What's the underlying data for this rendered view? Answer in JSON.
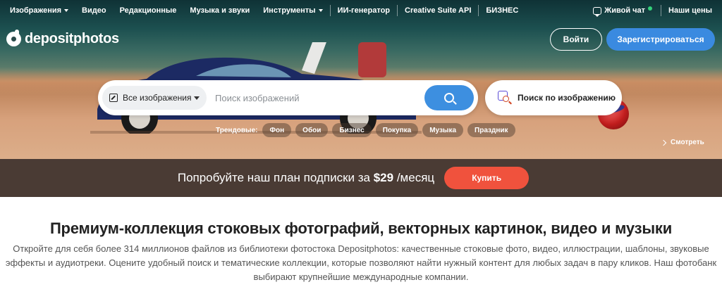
{
  "nav": {
    "items": [
      {
        "label": "Изображения",
        "dropdown": true
      },
      {
        "label": "Видео",
        "dropdown": false
      },
      {
        "label": "Редакционные",
        "dropdown": false
      },
      {
        "label": "Музыка и звуки",
        "dropdown": false
      },
      {
        "label": "Инструменты",
        "dropdown": true
      },
      {
        "label": "ИИ-генератор",
        "dropdown": false
      },
      {
        "label": "Creative Suite API",
        "dropdown": false
      },
      {
        "label": "БИЗНЕС",
        "dropdown": false
      }
    ],
    "live_chat": "Живой чат",
    "prices": "Наши цены"
  },
  "brand": {
    "name": "depositphotos"
  },
  "auth": {
    "login": "Войти",
    "register": "Зарегистрироваться"
  },
  "search": {
    "type_selected": "Все изображения",
    "placeholder": "Поиск изображений",
    "image_search_label": "Поиск по изображению"
  },
  "trending": {
    "label": "Трендовые:",
    "tags": [
      "Фон",
      "Обои",
      "Бизнес",
      "Покупка",
      "Музыка",
      "Праздник"
    ]
  },
  "hero": {
    "see_label": "Смотреть"
  },
  "promo": {
    "text_before": "Попробуйте наш план подписки за",
    "price": "$29",
    "text_after": "/месяц",
    "button": "Купить"
  },
  "content": {
    "title": "Премиум-коллекция стоковых фотографий, векторных картинок, видео и музыки",
    "description": "Откройте для себя более 314 миллионов файлов из библиотеки фотостока Depositphotos: качественные стоковые фото, видео, иллюстрации, шаблоны, звуковые эффекты и аудиотреки. Оцените удобный поиск и тематические коллекции, которые позволяют найти нужный контент для любых задач в пару кликов. Наш фотобанк выбирают крупнейшие международные компании."
  },
  "colors": {
    "accent_blue": "#3a8ae0",
    "promo_bg": "#4a3b34",
    "buy_button": "#f0523d",
    "online_dot": "#34d17a"
  }
}
